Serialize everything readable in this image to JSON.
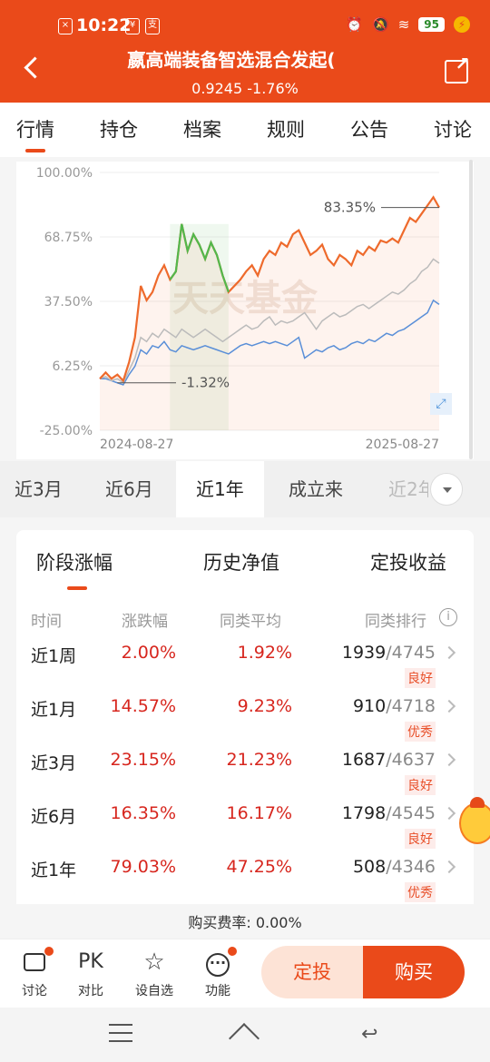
{
  "status": {
    "time": "10:22",
    "battery": "95"
  },
  "header": {
    "title": "嬴高端装备智选混合发起(",
    "nav": "0.9245",
    "change": "-1.76%"
  },
  "tabs": [
    "行情",
    "持仓",
    "档案",
    "规则",
    "公告",
    "讨论"
  ],
  "chart_data": {
    "type": "line",
    "x_start": "2024-08-27",
    "x_end": "2025-08-27",
    "y_ticks": [
      "100.00%",
      "68.75%",
      "37.50%",
      "6.25%",
      "-25.00%"
    ],
    "ylim": [
      -25,
      100
    ],
    "annotations": {
      "end_value": "83.35%",
      "low_value": "-1.32%"
    },
    "watermark": "天天基金",
    "series": [
      {
        "color": "#ee6a2c",
        "values": [
          0,
          3,
          0,
          2,
          -1,
          8,
          20,
          45,
          38,
          42,
          50,
          55,
          48,
          52,
          75,
          62,
          70,
          65,
          58,
          66,
          60,
          50,
          42,
          45,
          48,
          52,
          55,
          50,
          58,
          62,
          60,
          66,
          64,
          70,
          72,
          66,
          60,
          62,
          65,
          58,
          55,
          60,
          58,
          55,
          62,
          60,
          64,
          62,
          67,
          66,
          68,
          66,
          72,
          78,
          76,
          80,
          84,
          88,
          83
        ]
      },
      {
        "color": "#bbbbbb",
        "values": [
          0,
          1,
          -1,
          0,
          -2,
          4,
          10,
          20,
          18,
          22,
          20,
          24,
          22,
          20,
          24,
          22,
          20,
          22,
          24,
          22,
          20,
          18,
          20,
          22,
          24,
          26,
          24,
          25,
          28,
          30,
          26,
          28,
          27,
          28,
          30,
          32,
          28,
          24,
          28,
          30,
          32,
          30,
          31,
          33,
          35,
          36,
          34,
          36,
          38,
          40,
          42,
          41,
          43,
          46,
          48,
          52,
          54,
          58,
          56
        ]
      },
      {
        "color": "#5a8fd8",
        "values": [
          0,
          0,
          -1,
          -2,
          -3,
          2,
          6,
          14,
          12,
          16,
          15,
          18,
          14,
          13,
          16,
          15,
          14,
          15,
          16,
          15,
          14,
          13,
          12,
          14,
          16,
          17,
          16,
          17,
          18,
          17,
          18,
          17,
          16,
          18,
          20,
          10,
          12,
          14,
          13,
          15,
          16,
          14,
          15,
          17,
          18,
          17,
          19,
          18,
          20,
          22,
          21,
          23,
          24,
          26,
          28,
          30,
          32,
          38,
          36
        ]
      }
    ]
  },
  "periods": [
    "近3月",
    "近6月",
    "近1年",
    "成立来",
    "近2年"
  ],
  "perf": {
    "subtabs": [
      "阶段涨幅",
      "历史净值",
      "定投收益"
    ],
    "headers": [
      "时间",
      "涨跌幅",
      "同类平均",
      "同类排行"
    ],
    "rows": [
      {
        "period": "近1周",
        "change": "2.00%",
        "avg": "1.92%",
        "rank": "1939",
        "total": "/4745",
        "badge": "良好"
      },
      {
        "period": "近1月",
        "change": "14.57%",
        "avg": "9.23%",
        "rank": "910",
        "total": "/4718",
        "badge": "优秀"
      },
      {
        "period": "近3月",
        "change": "23.15%",
        "avg": "21.23%",
        "rank": "1687",
        "total": "/4637",
        "badge": "良好"
      },
      {
        "period": "近6月",
        "change": "16.35%",
        "avg": "16.17%",
        "rank": "1798",
        "total": "/4545",
        "badge": "良好"
      },
      {
        "period": "近1年",
        "change": "79.03%",
        "avg": "47.25%",
        "rank": "508",
        "total": "/4346",
        "badge": "优秀"
      }
    ]
  },
  "fee": "购买费率: 0.00%",
  "bottom": {
    "items": [
      "讨论",
      "对比",
      "设自选",
      "功能"
    ],
    "pk": "PK",
    "dingtou": "定投",
    "buy": "购买"
  }
}
